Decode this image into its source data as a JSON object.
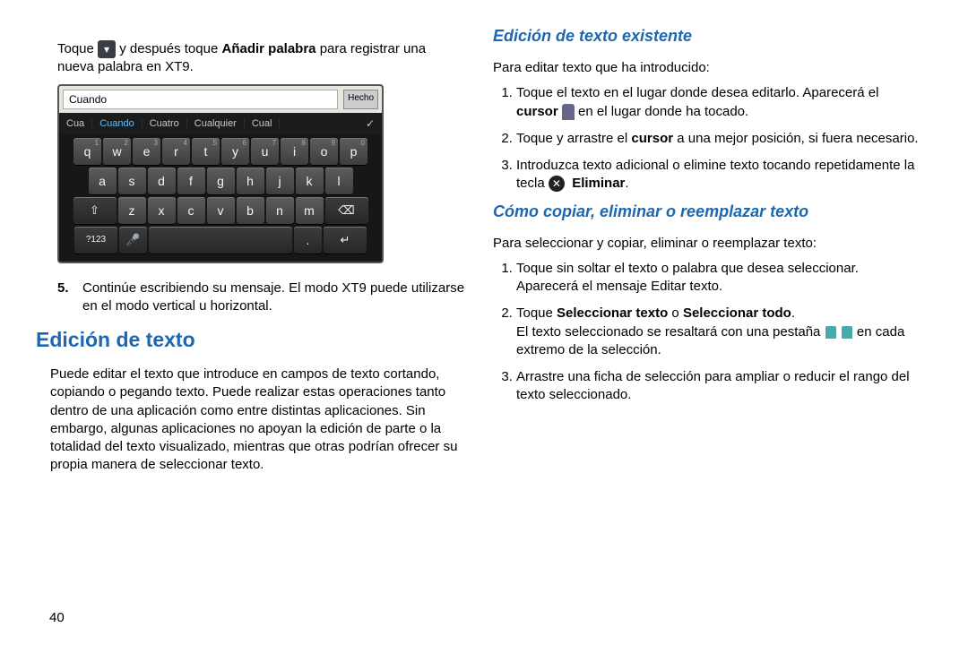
{
  "left": {
    "intro_pre": "Toque ",
    "intro_mid": " y después toque ",
    "intro_bold": "Añadir palabra",
    "intro_post": " para registrar una nueva palabra en XT9.",
    "kb": {
      "input_value": "Cuando",
      "done": "Hecho",
      "suggestions": [
        "Cua",
        "Cuando",
        "Cuatro",
        "Cualquier",
        "Cual"
      ],
      "row1": [
        {
          "k": "q",
          "s": "1"
        },
        {
          "k": "w",
          "s": "2"
        },
        {
          "k": "e",
          "s": "3"
        },
        {
          "k": "r",
          "s": "4"
        },
        {
          "k": "t",
          "s": "5"
        },
        {
          "k": "y",
          "s": "6"
        },
        {
          "k": "u",
          "s": "7"
        },
        {
          "k": "i",
          "s": "8"
        },
        {
          "k": "o",
          "s": "9"
        },
        {
          "k": "p",
          "s": "0"
        }
      ],
      "row2": [
        "a",
        "s",
        "d",
        "f",
        "g",
        "h",
        "j",
        "k",
        "l"
      ],
      "row3_shift": "⇧",
      "row3": [
        "z",
        "x",
        "c",
        "v",
        "b",
        "n",
        "m"
      ],
      "row3_del": "⌫",
      "row4_sym": "?123",
      "row4_mic": "🎤",
      "row4_period": ".",
      "row4_enter": "↵"
    },
    "step5_num": "5.",
    "step5": "Continúe escribiendo su mensaje. El modo XT9 puede utilizarse en el modo vertical u horizontal.",
    "h2": "Edición de texto",
    "p1": "Puede editar el texto que introduce en campos de texto cortando, copiando o pegando texto. Puede realizar estas operaciones tanto dentro de una aplicación como entre distintas aplicaciones. Sin embargo, algunas aplicaciones no apoyan la edición de parte o la totalidad del texto visualizado, mientras que otras podrían ofrecer su propia manera de seleccionar texto."
  },
  "right": {
    "h3a": "Edición de texto existente",
    "pa": "Para editar texto que ha introducido:",
    "li1a": "Toque el texto en el lugar donde desea editarlo. Aparecerá el ",
    "li1b_bold": "cursor",
    "li1c": " en el lugar donde ha tocado.",
    "li2a": "Toque y arrastre el ",
    "li2b_bold": "cursor",
    "li2c": " a una mejor posición, si fuera necesario.",
    "li3a": "Introduzca texto adicional o elimine texto tocando repetidamente la tecla ",
    "li3b_bold": "Eliminar",
    "li3c": ".",
    "h3b": "Cómo copiar, eliminar o reemplazar texto",
    "pb": "Para seleccionar y copiar, eliminar o reemplazar texto:",
    "lb1": "Toque sin soltar el texto o palabra que desea seleccionar. Aparecerá el mensaje Editar texto.",
    "lb2a": "Toque ",
    "lb2b_bold1": "Seleccionar texto",
    "lb2c": " o ",
    "lb2d_bold2": "Seleccionar todo",
    "lb2e": ".",
    "lb2f": "El texto seleccionado se resaltará con una pestaña ",
    "lb2g": " en cada extremo de la selección.",
    "lb3": "Arrastre una ficha de selección para ampliar o reducir el rango del texto seleccionado."
  },
  "page_number": "40"
}
